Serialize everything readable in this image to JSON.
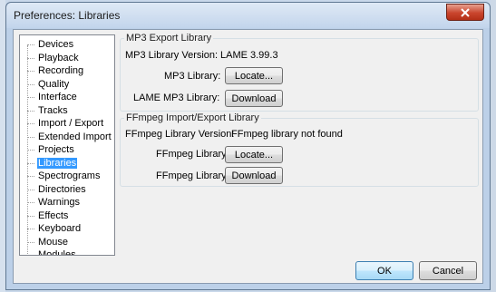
{
  "window": {
    "title": "Preferences: Libraries",
    "close_icon": "close-icon"
  },
  "sidebar": {
    "items": [
      {
        "label": "Devices",
        "selected": false
      },
      {
        "label": "Playback",
        "selected": false
      },
      {
        "label": "Recording",
        "selected": false
      },
      {
        "label": "Quality",
        "selected": false
      },
      {
        "label": "Interface",
        "selected": false
      },
      {
        "label": "Tracks",
        "selected": false
      },
      {
        "label": "Import / Export",
        "selected": false
      },
      {
        "label": "Extended Import",
        "selected": false
      },
      {
        "label": "Projects",
        "selected": false
      },
      {
        "label": "Libraries",
        "selected": true
      },
      {
        "label": "Spectrograms",
        "selected": false
      },
      {
        "label": "Directories",
        "selected": false
      },
      {
        "label": "Warnings",
        "selected": false
      },
      {
        "label": "Effects",
        "selected": false
      },
      {
        "label": "Keyboard",
        "selected": false
      },
      {
        "label": "Mouse",
        "selected": false
      },
      {
        "label": "Modules",
        "selected": false
      }
    ]
  },
  "mp3": {
    "group_title": "MP3 Export Library",
    "version_label": "MP3 Library Version:",
    "version_value": "LAME 3.99.3",
    "library_label": "MP3 Library:",
    "locate_button": "Locate...",
    "lame_label": "LAME MP3 Library:",
    "download_button": "Download"
  },
  "ffmpeg": {
    "group_title": "FFmpeg Import/Export Library",
    "version_label": "FFmpeg Library Version:",
    "version_value": "FFmpeg library not found",
    "library_label": "FFmpeg Library:",
    "locate_button": "Locate...",
    "download_label": "FFmpeg Library:",
    "download_button": "Download"
  },
  "footer": {
    "ok_button": "OK",
    "cancel_button": "Cancel"
  }
}
